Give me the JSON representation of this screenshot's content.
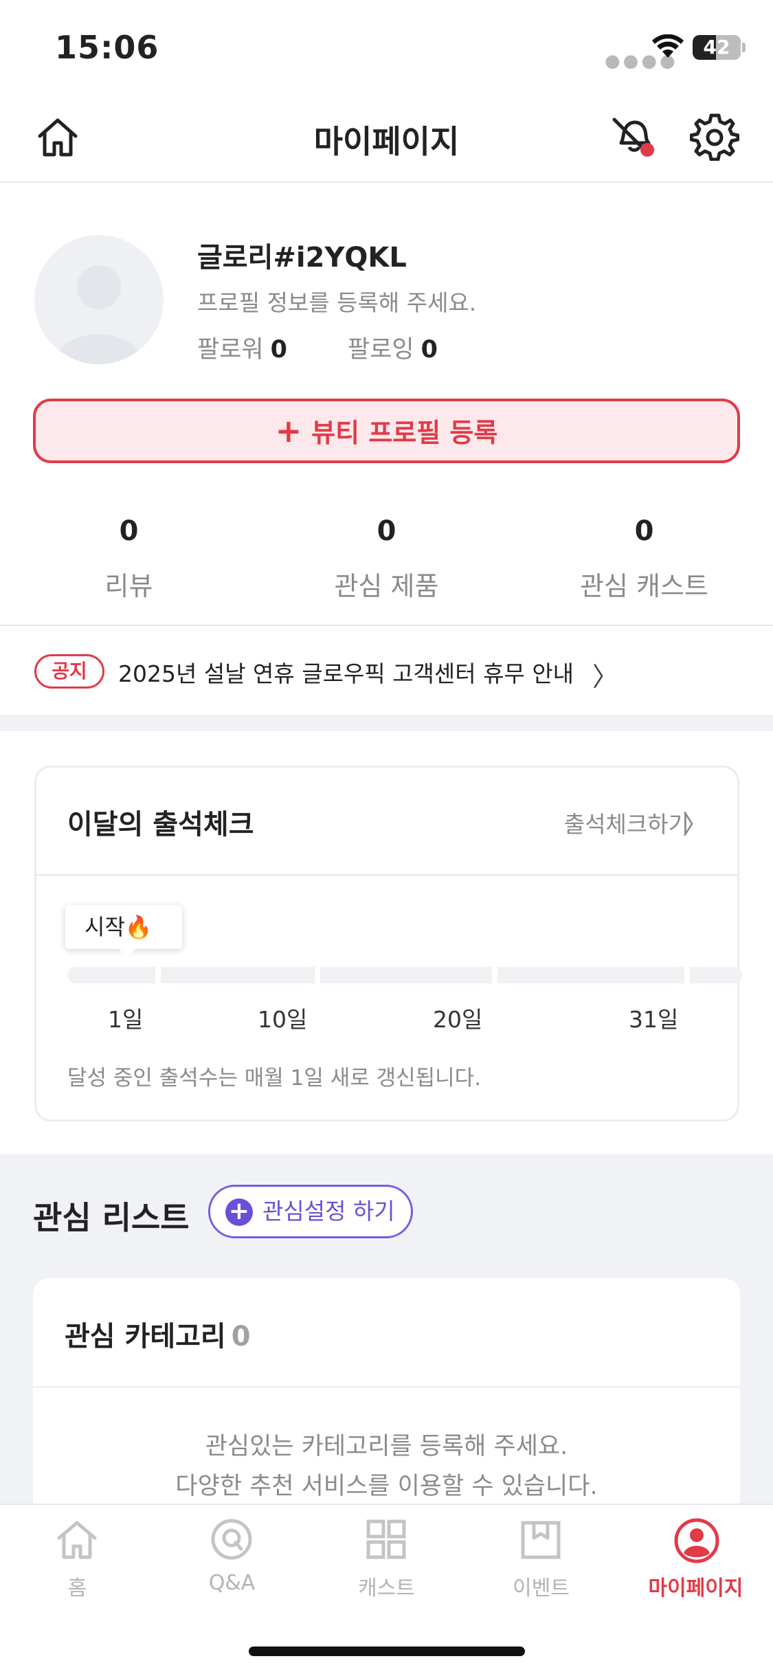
{
  "status_bar": {
    "time": "15:06",
    "battery": "42"
  },
  "header": {
    "title": "마이페이지"
  },
  "profile": {
    "nickname": "글로리#i2YQKL",
    "hint": "프로필 정보를 등록해 주세요.",
    "followers_label": "팔로워",
    "followers_count": "0",
    "following_label": "팔로잉",
    "following_count": "0"
  },
  "beauty_button": {
    "plus": "+",
    "label": "뷰티 프로필 등록"
  },
  "stats": [
    {
      "count": "0",
      "label": "리뷰"
    },
    {
      "count": "0",
      "label": "관심 제품"
    },
    {
      "count": "0",
      "label": "관심 캐스트"
    }
  ],
  "notice": {
    "badge": "공지",
    "text": "2025년 설날 연휴 글로우픽 고객센터 휴무 안내",
    "chevron": "〉"
  },
  "attendance": {
    "title": "이달의 출석체크",
    "link": "출석체크하기",
    "chevron": "〉",
    "start_label": "시작🔥",
    "days": [
      "1일",
      "10일",
      "20일",
      "31일"
    ],
    "note": "달성 중인 출석수는 매월 1일 새로 갱신됩니다."
  },
  "interest": {
    "title": "관심 리스트",
    "button_label": "관심설정 하기",
    "button_plus": "+",
    "category_title": "관심 카테고리",
    "category_count": "0",
    "empty_line1": "관심있는 카테고리를 등록해 주세요.",
    "empty_line2": "다양한 추천 서비스를 이용할 수 있습니다."
  },
  "tabs": [
    {
      "label": "홈",
      "icon": "home-icon",
      "active": false
    },
    {
      "label": "Q&A",
      "icon": "qa-icon",
      "active": false
    },
    {
      "label": "캐스트",
      "icon": "grid-icon",
      "active": false
    },
    {
      "label": "이벤트",
      "icon": "gift-box-icon",
      "active": false
    },
    {
      "label": "마이페이지",
      "icon": "profile-icon",
      "active": true
    }
  ],
  "colors": {
    "accent": "#e23a48",
    "purple": "#6b4fd6",
    "gray_bg": "#f1f2f6"
  }
}
